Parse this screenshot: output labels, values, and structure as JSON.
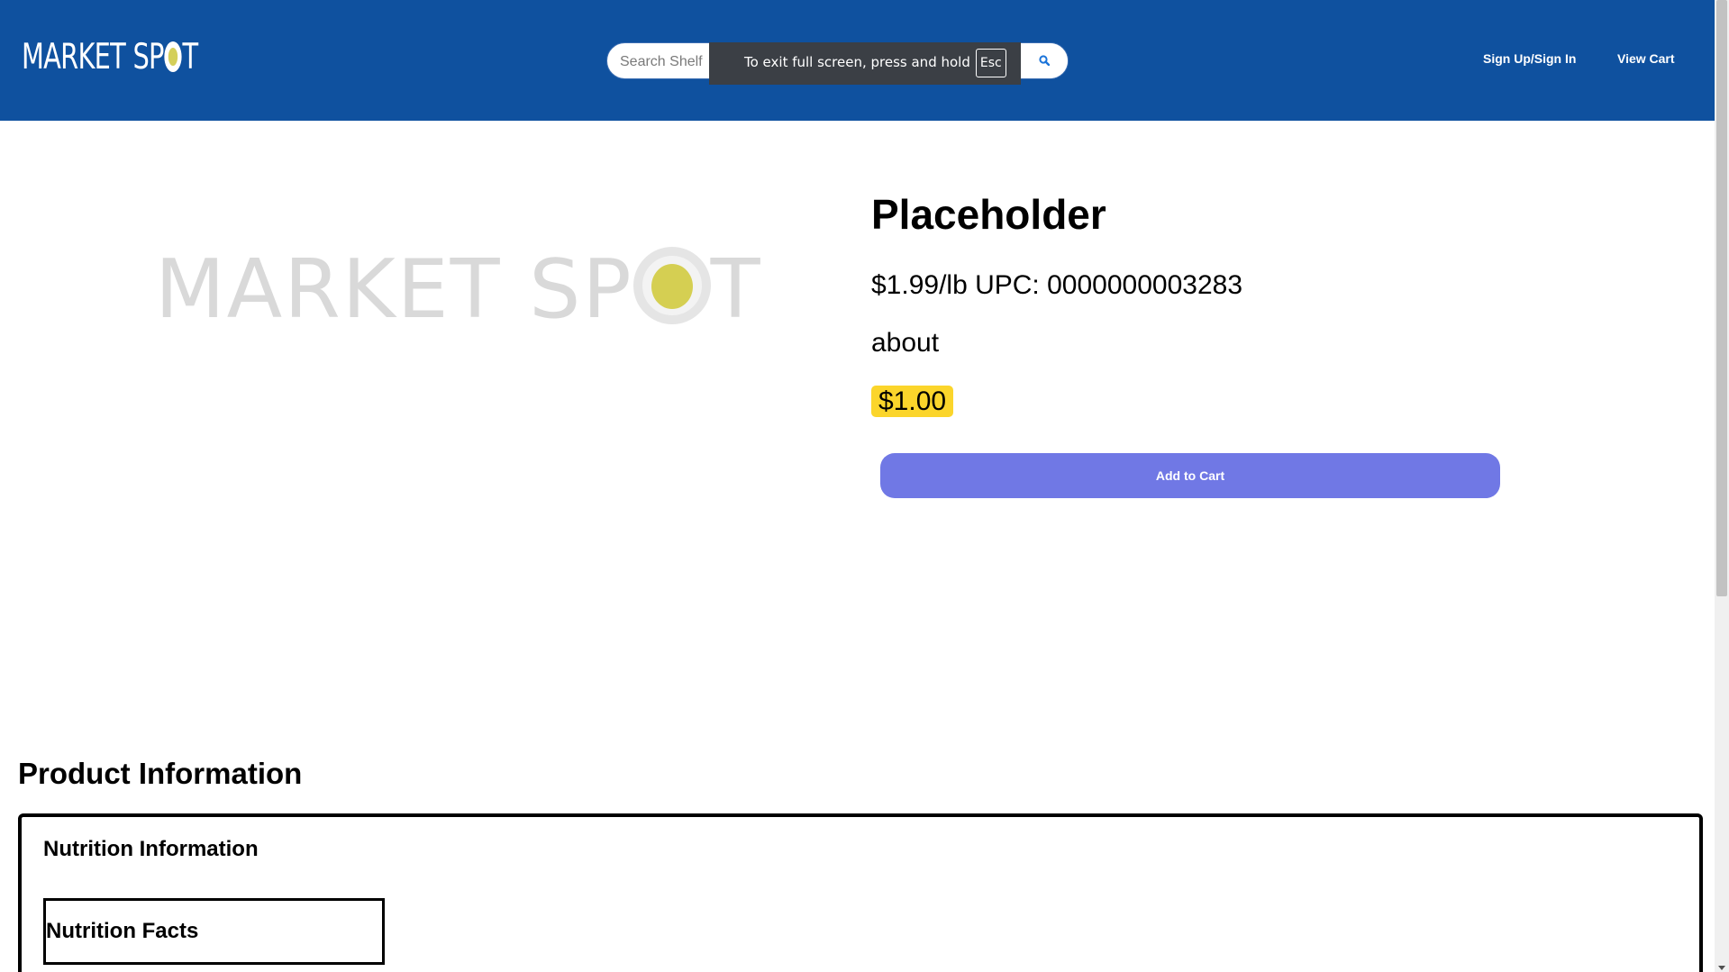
{
  "header": {
    "logo_left": "MARKET SP",
    "logo_right": "T",
    "search": {
      "placeholder": "Search Shelf"
    },
    "fullscreen_notice": {
      "text": "To exit full screen, press and hold",
      "key": "Esc"
    },
    "nav": {
      "sign_in": "Sign Up/Sign In",
      "view_cart": "View Cart"
    },
    "colors": {
      "background": "#0f519f",
      "logo_dot": "#d4cf5a"
    }
  },
  "product": {
    "image_text_left": "MARKET SP",
    "image_text_right": "T",
    "title": "Placeholder",
    "price_line": "$1.99/lb UPC: 0000000003283",
    "about": "about",
    "estimated_price": "$1.00",
    "add_to_cart_label": "Add to Cart",
    "colors": {
      "price_badge": "#fbd52b",
      "add_to_cart": "#7078e5"
    }
  },
  "product_information": {
    "title": "Product Information",
    "nutrition_heading": "Nutrition Information",
    "nutrition_facts_title": "Nutrition Facts"
  }
}
